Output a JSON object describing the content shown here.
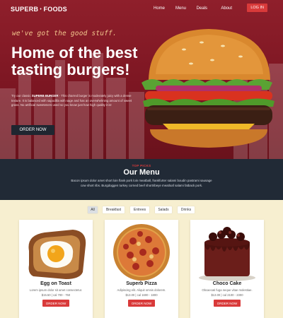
{
  "nav": {
    "logo_left": "SUPERB",
    "logo_right": "FOODS",
    "links": [
      "Home",
      "Menu",
      "Deals",
      "About"
    ],
    "login": "LOG IN"
  },
  "hero": {
    "tagline": "we've got the good stuff.",
    "headline": "Home of the best tasting burgers!",
    "lead_prefix": "Try our classic ",
    "lead_bold": "SUPERB BURGER",
    "lead_rest": " - This charred burger is moderately juicy with a dense texture. It is balanced with sapodilla with sage and has an overwhelming amount of sweet grass. No artificial sweeteners used so you know just how high quality it is!",
    "order_label": "ORDER NOW"
  },
  "menu": {
    "eyebrow": "TOP PICKS",
    "title": "Our Menu",
    "description": "Bacon ipsum dolor amet short loin flank pork loin meatball, frankfurter salami boudin pastrami sausage cow short ribs. Burgdoggen turkey corned beef shortribeye meatloaf salami fatback pork.",
    "filters": [
      "All",
      "Breakfast",
      "Entrees",
      "Salads",
      "Drinks"
    ],
    "active_filter": "All",
    "cards": [
      {
        "title": "Egg on Toast",
        "desc": "Lorem ipsum dolor sit amet consectetur.",
        "price": "$15.50 | cal 700 - 750",
        "button": "ORDER NOW"
      },
      {
        "title": "Superb Pizza",
        "desc": "Adipiscing elit. Aliquit omnis dolorem.",
        "price": "$13.00 | cal 1600 - 1800",
        "button": "ORDER NOW"
      },
      {
        "title": "Choco Cake",
        "desc": "Obcaecati fuga neque vitae molestiae.",
        "price": "$13.00 | cal 2100 - 2300",
        "button": "ORDER NOW"
      }
    ]
  },
  "colors": {
    "hero_red": "#7c1622",
    "accent_red": "#d93a3a",
    "dark_navy": "#212a36",
    "cream": "#f7efd0"
  }
}
